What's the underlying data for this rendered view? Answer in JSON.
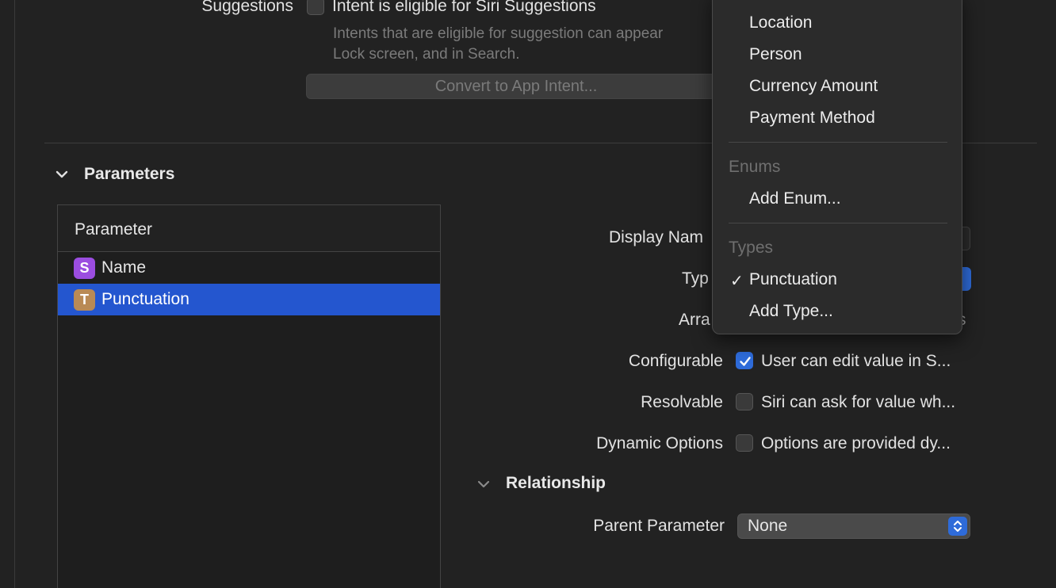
{
  "siri": {
    "label": "Suggestions",
    "checkbox_label": "Intent is eligible for Siri Suggestions",
    "description_line1": "Intents that are eligible for suggestion can appear",
    "description_line2": "Lock screen, and in Search."
  },
  "convert_button": "Convert to App Intent...",
  "parameters": {
    "title": "Parameters",
    "table_header": "Parameter",
    "rows": [
      {
        "badge": "S",
        "badge_color": "#9b4de0",
        "label": "Name"
      },
      {
        "badge": "T",
        "badge_color": "#b98a55",
        "label": "Punctuation"
      }
    ]
  },
  "form": {
    "display_name_label": "Display Nam",
    "type_label": "Typ",
    "array_label": "Arra",
    "array_cut": "s",
    "configurable": {
      "label": "Configurable",
      "text": "User can edit value in S...",
      "checked": true
    },
    "resolvable": {
      "label": "Resolvable",
      "text": "Siri can ask for value wh...",
      "checked": false
    },
    "dynamic": {
      "label": "Dynamic Options",
      "text": "Options are provided dy...",
      "checked": false
    }
  },
  "relationship": {
    "title": "Relationship",
    "parent_label": "Parent Parameter",
    "parent_value": "None"
  },
  "menu": {
    "items_top": [
      "Location",
      "Person",
      "Currency Amount",
      "Payment Method"
    ],
    "enums_header": "Enums",
    "add_enum": "Add Enum...",
    "types_header": "Types",
    "selected_type": "Punctuation",
    "check_mark": "✓",
    "add_type": "Add Type..."
  },
  "colors": {
    "accent": "#2e6bd9",
    "selection": "#2456cf",
    "background": "#222222"
  }
}
